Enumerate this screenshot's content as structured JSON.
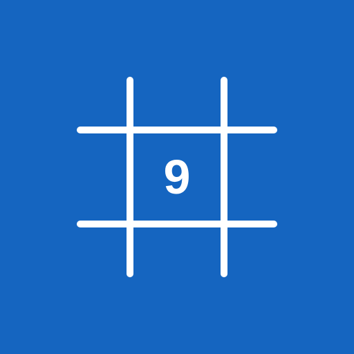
{
  "app_icon": {
    "digit": "9",
    "background_color": "#1565C0",
    "line_color": "#FFFFFF",
    "digit_color": "#FFFFFF",
    "icon_name": "sudoku-grid-icon"
  }
}
